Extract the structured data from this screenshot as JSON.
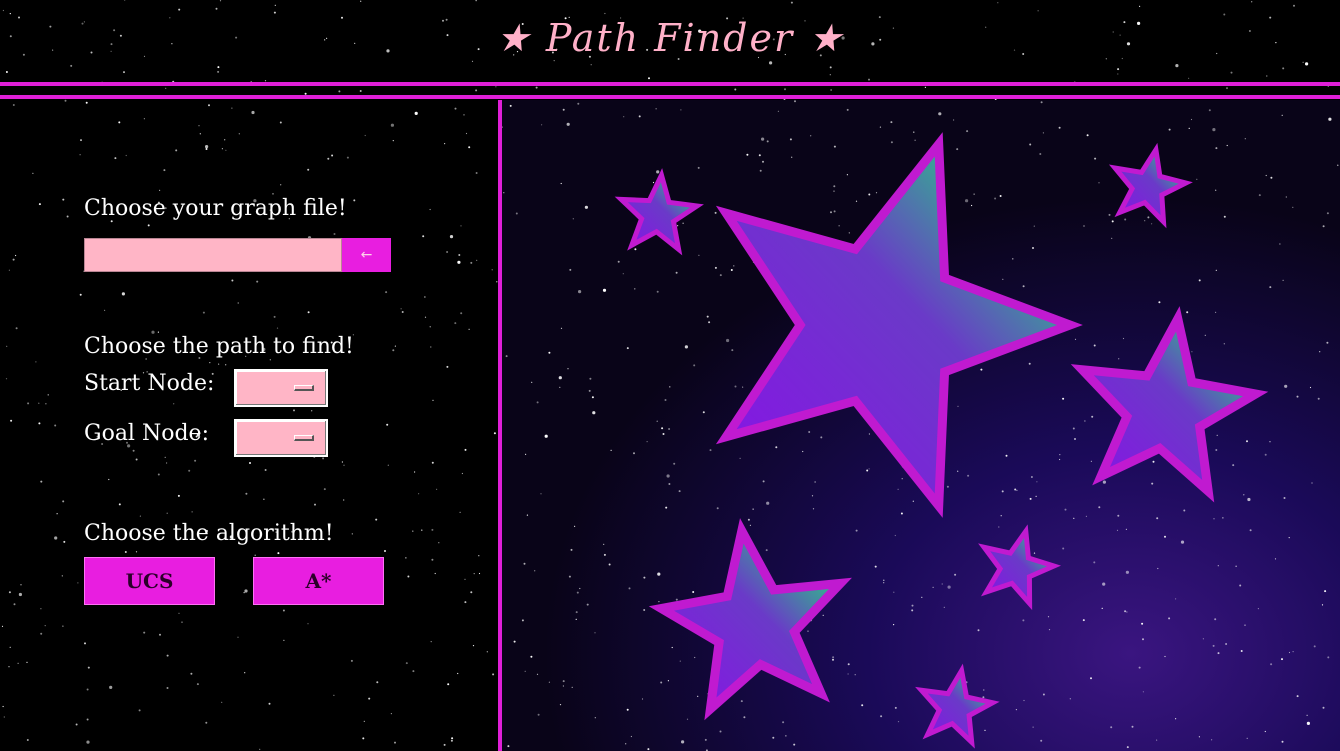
{
  "window": {
    "title": "★ Path Finder ★"
  },
  "sidebar": {
    "file_section": {
      "label": "Choose your graph file!",
      "input_value": "",
      "browse_label": "←"
    },
    "path_section": {
      "label": "Choose the path to find!",
      "start_label": "Start Node:",
      "start_value": "",
      "goal_label": "Goal Node:",
      "goal_value": ""
    },
    "algo_section": {
      "label": "Choose the algorithm!",
      "buttons": [
        "UCS",
        "A*"
      ]
    }
  },
  "theme": {
    "accent": "#e81ee0",
    "title_color": "#ffb0c8",
    "field_color": "#ffb5c6",
    "star_gradient": [
      "#7a1fe0",
      "#18f070"
    ],
    "star_outline": "#c01ad0"
  }
}
